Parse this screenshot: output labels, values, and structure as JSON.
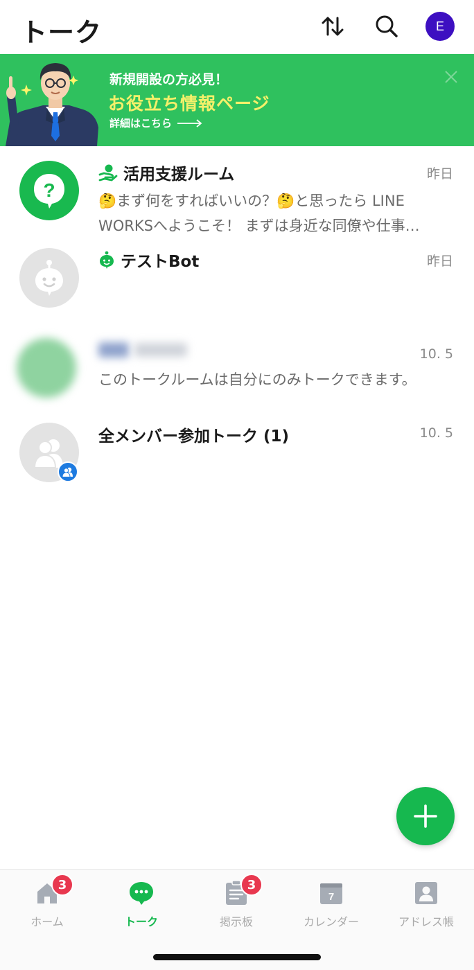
{
  "header": {
    "title": "トーク",
    "sort_icon": "sort-arrows-icon",
    "search_icon": "search-icon",
    "avatar_initial": "E",
    "avatar_color": "#3d0fc1"
  },
  "banner": {
    "line1": "新規開設の方必見！",
    "line2": "お役立ち情報ページ",
    "line3": "詳細はこちら",
    "bg_color": "#2fc15e",
    "highlight_color": "#f5f06a"
  },
  "talks": [
    {
      "name": "活用支援ルーム",
      "date": "昨日",
      "message": "🤔まず何をすればいいの？🤔と思ったら LINE WORKSへようこそ！ まずは身近な同僚や仕事…",
      "badge_icon": "support-person-icon",
      "avatar_icon": "question-icon"
    },
    {
      "name": "テストBot",
      "date": "昨日",
      "message": "",
      "badge_icon": "bot-icon",
      "avatar_icon": "bot-face-icon"
    },
    {
      "name": "",
      "date": "10. 5",
      "message": "このトークルームは自分にのみトークできます。",
      "avatar_icon": "blurred-avatar"
    },
    {
      "name": "全メンバー参加トーク (1)",
      "date": "10. 5",
      "message": "",
      "avatar_icon": "group-icon"
    }
  ],
  "fab": {
    "icon": "plus-icon"
  },
  "bottom_nav": [
    {
      "label": "ホーム",
      "icon": "home-icon",
      "badge": "3",
      "active": false
    },
    {
      "label": "トーク",
      "icon": "chat-bubble-icon",
      "badge": "",
      "active": true
    },
    {
      "label": "掲示板",
      "icon": "board-icon",
      "badge": "3",
      "active": false
    },
    {
      "label": "カレンダー",
      "icon": "calendar-icon",
      "calendar_day": "7",
      "active": false
    },
    {
      "label": "アドレス帳",
      "icon": "address-book-icon",
      "badge": "",
      "active": false
    }
  ],
  "colors": {
    "accent": "#16b84f",
    "badge": "#e8384f"
  }
}
